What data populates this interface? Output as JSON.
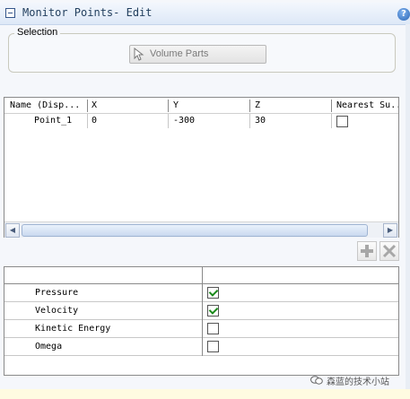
{
  "panel": {
    "title": "Monitor Points- Edit",
    "help_label": "?"
  },
  "selection": {
    "group_label": "Selection",
    "button_label": "Volume Parts"
  },
  "points_table": {
    "columns": [
      "Name (Disp...",
      "X",
      "Y",
      "Z",
      "Nearest Su..."
    ],
    "rows": [
      {
        "name": "Point_1",
        "x": "0",
        "y": "-300",
        "z": "30",
        "nearest": false
      }
    ],
    "scroll_left_icon": "scroll-left-arrow",
    "scroll_right_icon": "scroll-right-arrow"
  },
  "toolbar": {
    "add_icon": "plus-icon",
    "remove_icon": "x-icon"
  },
  "quantities": {
    "rows": [
      {
        "label": "Pressure",
        "checked": true
      },
      {
        "label": "Velocity",
        "checked": true
      },
      {
        "label": "Kinetic Energy",
        "checked": false
      },
      {
        "label": "Omega",
        "checked": false
      }
    ]
  },
  "watermark": {
    "text": "森蓝的技术小站"
  },
  "colors": {
    "header_bg": "#dde8f7",
    "check_green": "#1b8a1b",
    "accent_blue": "#2c66b5"
  }
}
